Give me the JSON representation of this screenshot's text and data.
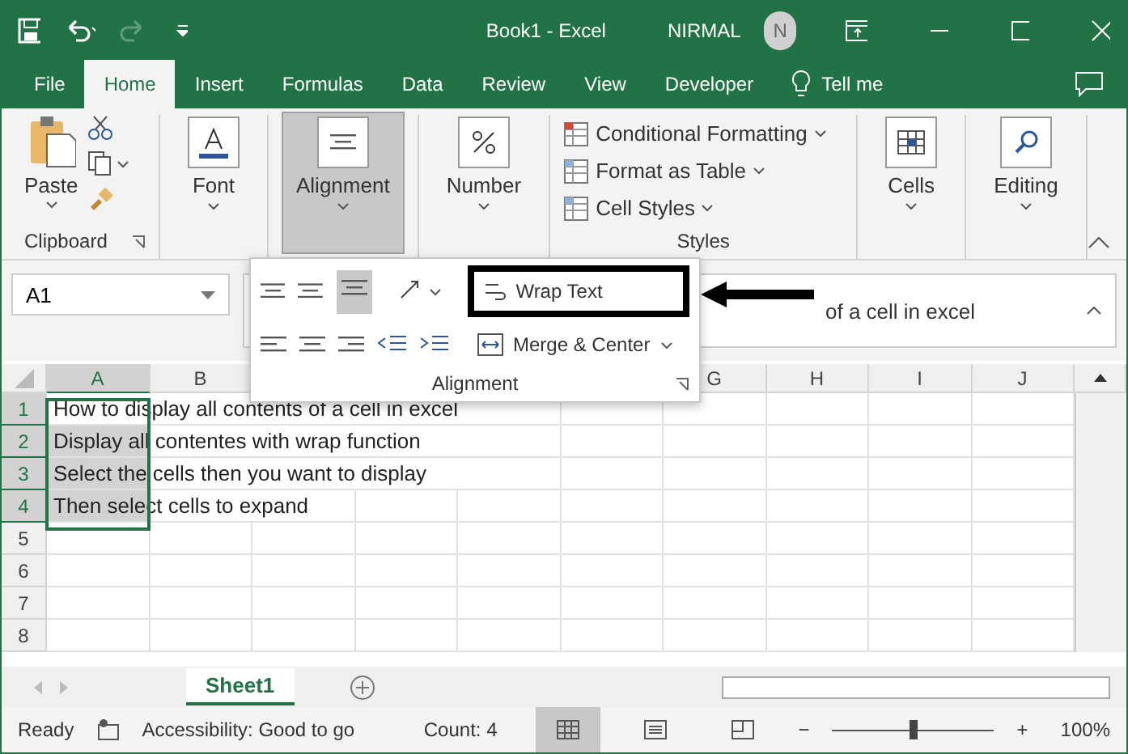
{
  "window": {
    "title": "Book1  -  Excel",
    "user": "NIRMAL",
    "avatar": "N"
  },
  "ribbon_tabs": [
    {
      "label": "File",
      "selected": false
    },
    {
      "label": "Home",
      "selected": true
    },
    {
      "label": "Insert",
      "selected": false
    },
    {
      "label": "Formulas",
      "selected": false
    },
    {
      "label": "Data",
      "selected": false
    },
    {
      "label": "Review",
      "selected": false
    },
    {
      "label": "View",
      "selected": false
    },
    {
      "label": "Developer",
      "selected": false
    }
  ],
  "tell_me": "Tell me",
  "ribbon": {
    "clipboard": {
      "paste": "Paste",
      "label": "Clipboard"
    },
    "groups": [
      {
        "label": "Font",
        "pressed": false
      },
      {
        "label": "Alignment",
        "pressed": true
      },
      {
        "label": "Number",
        "pressed": false
      }
    ],
    "styles": {
      "items": [
        "Conditional Formatting",
        "Format as Table",
        "Cell Styles"
      ],
      "label": "Styles"
    },
    "tail_groups": [
      {
        "label": "Cells",
        "pressed": false
      },
      {
        "label": "Editing",
        "pressed": false
      }
    ]
  },
  "name_box": "A1",
  "formula": "of a cell in excel",
  "alignment_popup": {
    "wrap_text": "Wrap Text",
    "merge": "Merge & Center",
    "label": "Alignment"
  },
  "columns": [
    {
      "label": "A",
      "selected": true
    },
    {
      "label": "B",
      "selected": false
    },
    {
      "label": "G",
      "selected": false
    },
    {
      "label": "H",
      "selected": false
    },
    {
      "label": "I",
      "selected": false
    },
    {
      "label": "J",
      "selected": false
    }
  ],
  "rows": [
    {
      "number": "1",
      "text": "How to display all contents of a cell in excel",
      "selected": true
    },
    {
      "number": "2",
      "text": "Display all contentes with wrap function",
      "selected": true
    },
    {
      "number": "3",
      "text": "Select the cells then you want to display",
      "selected": true
    },
    {
      "number": "4",
      "text": "Then select cells to expand",
      "selected": true
    },
    {
      "number": "5",
      "selected": false
    },
    {
      "number": "6",
      "selected": false
    },
    {
      "number": "7",
      "selected": false
    },
    {
      "number": "8",
      "selected": false
    }
  ],
  "sheets": [
    {
      "label": "Sheet1",
      "selected": true
    }
  ],
  "status_bar": {
    "ready": "Ready",
    "accessibility": "Accessibility: Good to go",
    "count": "Count: 4",
    "zoom_out": "−",
    "zoom_in": "+",
    "zoom": "100%",
    "zoom_slider": {
      "level": 0.5
    }
  }
}
